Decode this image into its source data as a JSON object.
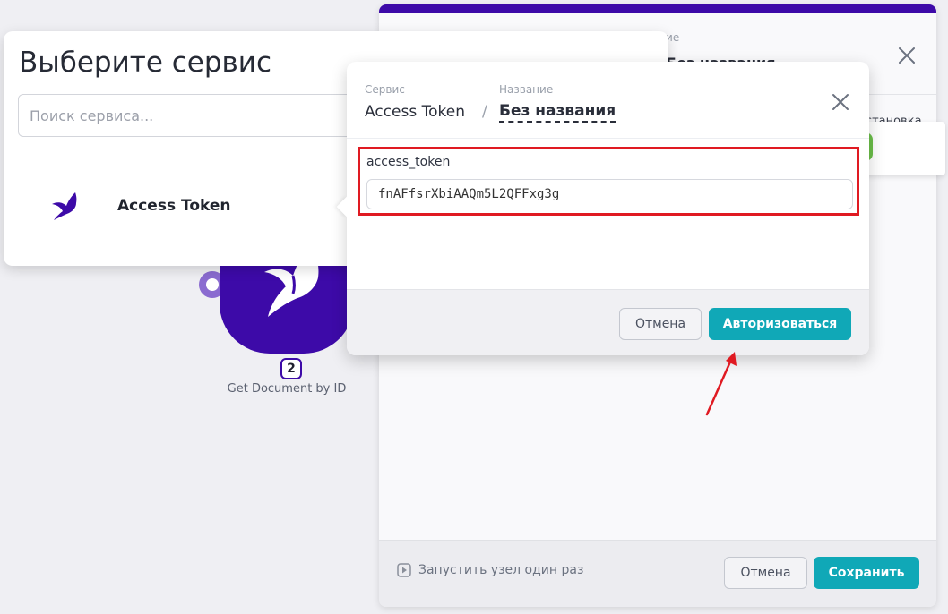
{
  "canvas": {
    "node": {
      "badge": "2",
      "label": "Get Document by ID"
    }
  },
  "module_panel": {
    "name_caption": "Название",
    "title": "Без названия",
    "install_label": "Установка",
    "footer": {
      "run_once_label": "Запустить узел один раз",
      "cancel_label": "Отмена",
      "save_label": "Сохранить"
    }
  },
  "service_picker": {
    "title": "Выберите сервис",
    "search_placeholder": "Поиск сервиса...",
    "items": [
      {
        "label": "Access Token",
        "icon": "hummingbird-icon"
      }
    ]
  },
  "auth_modal": {
    "service_caption": "Сервис",
    "service_value": "Access Token",
    "separator": "/",
    "name_caption": "Название",
    "name_value": "Без названия",
    "field": {
      "label": "access_token",
      "value": "fnAFfsrXbiAAQm5L2QFFxg3g"
    },
    "cancel_label": "Отмена",
    "authorize_label": "Авторизоваться"
  },
  "colors": {
    "brand": "#3d0aa8",
    "accent": "#10a8b7",
    "highlight_border": "#e01a22",
    "toggle_on": "#6cc04a"
  }
}
